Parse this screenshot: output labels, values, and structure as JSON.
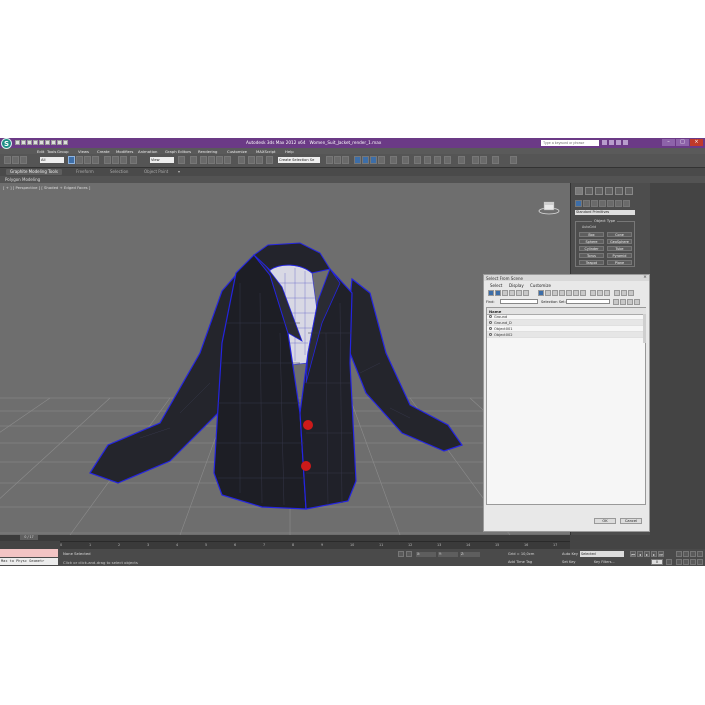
{
  "title_bar": {
    "app_title": "Autodesk 3ds Max  2012 x64",
    "file_name": "Women_Suit_Jacket_render_1.max",
    "help_search_placeholder": "Type a keyword or phrase"
  },
  "menu": [
    "Edit",
    "Tools",
    "Group",
    "Views",
    "Create",
    "Modifiers",
    "Animation",
    "Graph Editors",
    "Rendering",
    "Customize",
    "MAXScript",
    "Help"
  ],
  "toolbar": {
    "filter_select": "All",
    "refcoord_select": "View",
    "named_selection": "Create Selection Se"
  },
  "ribbon": {
    "tabs": [
      "Graphite Modeling Tools",
      "Freeform",
      "Selection",
      "Object Paint"
    ],
    "active_tab": 0,
    "sub_label": "Polygon Modeling"
  },
  "viewport": {
    "label": "[ + ] [ Perspective ] [ Shaded + Edged Faces ]"
  },
  "command_panel": {
    "dropdown": "Standard Primitives",
    "object_type_title": "Object Type",
    "autogrid": "AutoGrid",
    "primitives": [
      "Box",
      "Cone",
      "Sphere",
      "GeoSphere",
      "Cylinder",
      "Tube",
      "Torus",
      "Pyramid",
      "Teapot",
      "Plane"
    ]
  },
  "dialog": {
    "title": "Select From Scene",
    "menu": [
      "Select",
      "Display",
      "Customize"
    ],
    "find_label": "Find:",
    "selection_set_label": "Selection Set:",
    "column_header": "Name",
    "rows": [
      "Ground",
      "Ground_D",
      "Object001",
      "Object002"
    ],
    "ok": "OK",
    "cancel": "Cancel"
  },
  "timeline": {
    "slider_label": "0 / 17",
    "ticks": [
      "0",
      "1",
      "2",
      "3",
      "4",
      "5",
      "6",
      "7",
      "8",
      "9",
      "10",
      "11",
      "12",
      "13",
      "14",
      "15",
      "16",
      "17"
    ]
  },
  "status_bar": {
    "maxscript_text": "Max to Physc Geometr",
    "status": "None Selected",
    "prompt": "Click or click-and-drag to select objects",
    "x": "X:",
    "y": "Y:",
    "z": "Z:",
    "grid": "Grid = 10,0cm",
    "add_time_tag": "Add Time Tag",
    "auto_key": "Auto Key",
    "auto_key_select": "Selected",
    "set_key": "Set Key",
    "key_filters": "Key Filters...",
    "frame": "0"
  },
  "colors": {
    "title_bar": "#6b3a86",
    "viewport_bg": "#6e6e6e",
    "selection_blue": "#2020d8",
    "button_red": "#cc1a1a"
  }
}
